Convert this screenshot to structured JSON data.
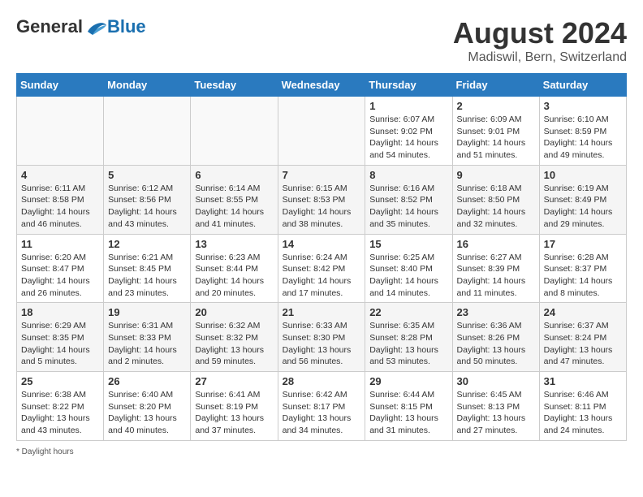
{
  "logo": {
    "general": "General",
    "blue": "Blue"
  },
  "title": {
    "month_year": "August 2024",
    "location": "Madiswil, Bern, Switzerland"
  },
  "days_of_week": [
    "Sunday",
    "Monday",
    "Tuesday",
    "Wednesday",
    "Thursday",
    "Friday",
    "Saturday"
  ],
  "weeks": [
    [
      {
        "day": "",
        "empty": true
      },
      {
        "day": "",
        "empty": true
      },
      {
        "day": "",
        "empty": true
      },
      {
        "day": "",
        "empty": true
      },
      {
        "day": "1",
        "sunrise": "6:07 AM",
        "sunset": "9:02 PM",
        "daylight": "14 hours and 54 minutes."
      },
      {
        "day": "2",
        "sunrise": "6:09 AM",
        "sunset": "9:01 PM",
        "daylight": "14 hours and 51 minutes."
      },
      {
        "day": "3",
        "sunrise": "6:10 AM",
        "sunset": "8:59 PM",
        "daylight": "14 hours and 49 minutes."
      }
    ],
    [
      {
        "day": "4",
        "sunrise": "6:11 AM",
        "sunset": "8:58 PM",
        "daylight": "14 hours and 46 minutes."
      },
      {
        "day": "5",
        "sunrise": "6:12 AM",
        "sunset": "8:56 PM",
        "daylight": "14 hours and 43 minutes."
      },
      {
        "day": "6",
        "sunrise": "6:14 AM",
        "sunset": "8:55 PM",
        "daylight": "14 hours and 41 minutes."
      },
      {
        "day": "7",
        "sunrise": "6:15 AM",
        "sunset": "8:53 PM",
        "daylight": "14 hours and 38 minutes."
      },
      {
        "day": "8",
        "sunrise": "6:16 AM",
        "sunset": "8:52 PM",
        "daylight": "14 hours and 35 minutes."
      },
      {
        "day": "9",
        "sunrise": "6:18 AM",
        "sunset": "8:50 PM",
        "daylight": "14 hours and 32 minutes."
      },
      {
        "day": "10",
        "sunrise": "6:19 AM",
        "sunset": "8:49 PM",
        "daylight": "14 hours and 29 minutes."
      }
    ],
    [
      {
        "day": "11",
        "sunrise": "6:20 AM",
        "sunset": "8:47 PM",
        "daylight": "14 hours and 26 minutes."
      },
      {
        "day": "12",
        "sunrise": "6:21 AM",
        "sunset": "8:45 PM",
        "daylight": "14 hours and 23 minutes."
      },
      {
        "day": "13",
        "sunrise": "6:23 AM",
        "sunset": "8:44 PM",
        "daylight": "14 hours and 20 minutes."
      },
      {
        "day": "14",
        "sunrise": "6:24 AM",
        "sunset": "8:42 PM",
        "daylight": "14 hours and 17 minutes."
      },
      {
        "day": "15",
        "sunrise": "6:25 AM",
        "sunset": "8:40 PM",
        "daylight": "14 hours and 14 minutes."
      },
      {
        "day": "16",
        "sunrise": "6:27 AM",
        "sunset": "8:39 PM",
        "daylight": "14 hours and 11 minutes."
      },
      {
        "day": "17",
        "sunrise": "6:28 AM",
        "sunset": "8:37 PM",
        "daylight": "14 hours and 8 minutes."
      }
    ],
    [
      {
        "day": "18",
        "sunrise": "6:29 AM",
        "sunset": "8:35 PM",
        "daylight": "14 hours and 5 minutes."
      },
      {
        "day": "19",
        "sunrise": "6:31 AM",
        "sunset": "8:33 PM",
        "daylight": "14 hours and 2 minutes."
      },
      {
        "day": "20",
        "sunrise": "6:32 AM",
        "sunset": "8:32 PM",
        "daylight": "13 hours and 59 minutes."
      },
      {
        "day": "21",
        "sunrise": "6:33 AM",
        "sunset": "8:30 PM",
        "daylight": "13 hours and 56 minutes."
      },
      {
        "day": "22",
        "sunrise": "6:35 AM",
        "sunset": "8:28 PM",
        "daylight": "13 hours and 53 minutes."
      },
      {
        "day": "23",
        "sunrise": "6:36 AM",
        "sunset": "8:26 PM",
        "daylight": "13 hours and 50 minutes."
      },
      {
        "day": "24",
        "sunrise": "6:37 AM",
        "sunset": "8:24 PM",
        "daylight": "13 hours and 47 minutes."
      }
    ],
    [
      {
        "day": "25",
        "sunrise": "6:38 AM",
        "sunset": "8:22 PM",
        "daylight": "13 hours and 43 minutes."
      },
      {
        "day": "26",
        "sunrise": "6:40 AM",
        "sunset": "8:20 PM",
        "daylight": "13 hours and 40 minutes."
      },
      {
        "day": "27",
        "sunrise": "6:41 AM",
        "sunset": "8:19 PM",
        "daylight": "13 hours and 37 minutes."
      },
      {
        "day": "28",
        "sunrise": "6:42 AM",
        "sunset": "8:17 PM",
        "daylight": "13 hours and 34 minutes."
      },
      {
        "day": "29",
        "sunrise": "6:44 AM",
        "sunset": "8:15 PM",
        "daylight": "13 hours and 31 minutes."
      },
      {
        "day": "30",
        "sunrise": "6:45 AM",
        "sunset": "8:13 PM",
        "daylight": "13 hours and 27 minutes."
      },
      {
        "day": "31",
        "sunrise": "6:46 AM",
        "sunset": "8:11 PM",
        "daylight": "13 hours and 24 minutes."
      }
    ]
  ],
  "note": "* Daylight hours"
}
